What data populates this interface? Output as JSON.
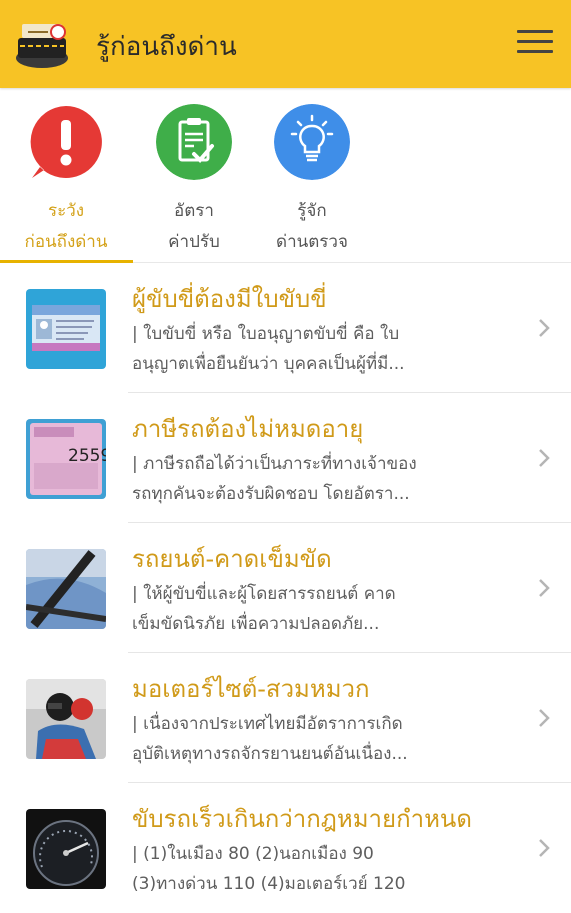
{
  "appbar": {
    "title": "รู้ก่อนถึงด่าน"
  },
  "tabs": [
    {
      "line1": "ระวัง",
      "line2": "ก่อนถึงด่าน",
      "icon": "warning-icon",
      "color": "#e53935",
      "active": true
    },
    {
      "line1": "อัตรา",
      "line2": "ค่าปรับ",
      "icon": "clipboard-check-icon",
      "color": "#3fae49",
      "active": false
    },
    {
      "line1": "รู้จัก",
      "line2": "ด่านตรวจ",
      "icon": "lightbulb-icon",
      "color": "#3f8ee8",
      "active": false
    }
  ],
  "items": [
    {
      "title": "ผู้ขับขี่ต้องมีใบขับขี่",
      "line1": "| ใบขับขี่ หรือ ใบอนุญาตขับขี่ คือ ใบ",
      "line2": "อนุญาตเพื่อยืนยันว่า บุคคลเป็นผู้ที่มี...",
      "thumb": "driver-license-thumbnail"
    },
    {
      "title": "ภาษีรถต้องไม่หมดอายุ",
      "line1": "| ภาษีรถถือได้ว่าเป็นภาระที่ทางเจ้าของ",
      "line2": "รถทุกคันจะต้องรับผิดชอบ โดยอัตรา...",
      "thumb": "tax-sticker-thumbnail",
      "sticker_year": "2559"
    },
    {
      "title": "รถยนต์-คาดเข็มขัด",
      "line1": "| ให้ผู้ขับขี่และผู้โดยสารรถยนต์ คาด",
      "line2": "เข็มขัดนิรภัย เพื่อความปลอดภัย...",
      "thumb": "seatbelt-thumbnail"
    },
    {
      "title": "มอเตอร์ไซต์-สวมหมวก",
      "line1": "| เนื่องจากประเทศไทยมีอัตราการเกิด",
      "line2": "อุบัติเหตุทางรถจักรยานยนต์อันเนื่อง...",
      "thumb": "helmet-thumbnail"
    },
    {
      "title": "ขับรถเร็วเกินกว่ากฎหมายกำหนด",
      "line1": "| (1)ในเมือง 80 (2)นอกเมือง 90",
      "line2": "(3)ทางด่วน 110 (4)มอเตอร์เวย์ 120",
      "thumb": "speedometer-thumbnail"
    }
  ]
}
